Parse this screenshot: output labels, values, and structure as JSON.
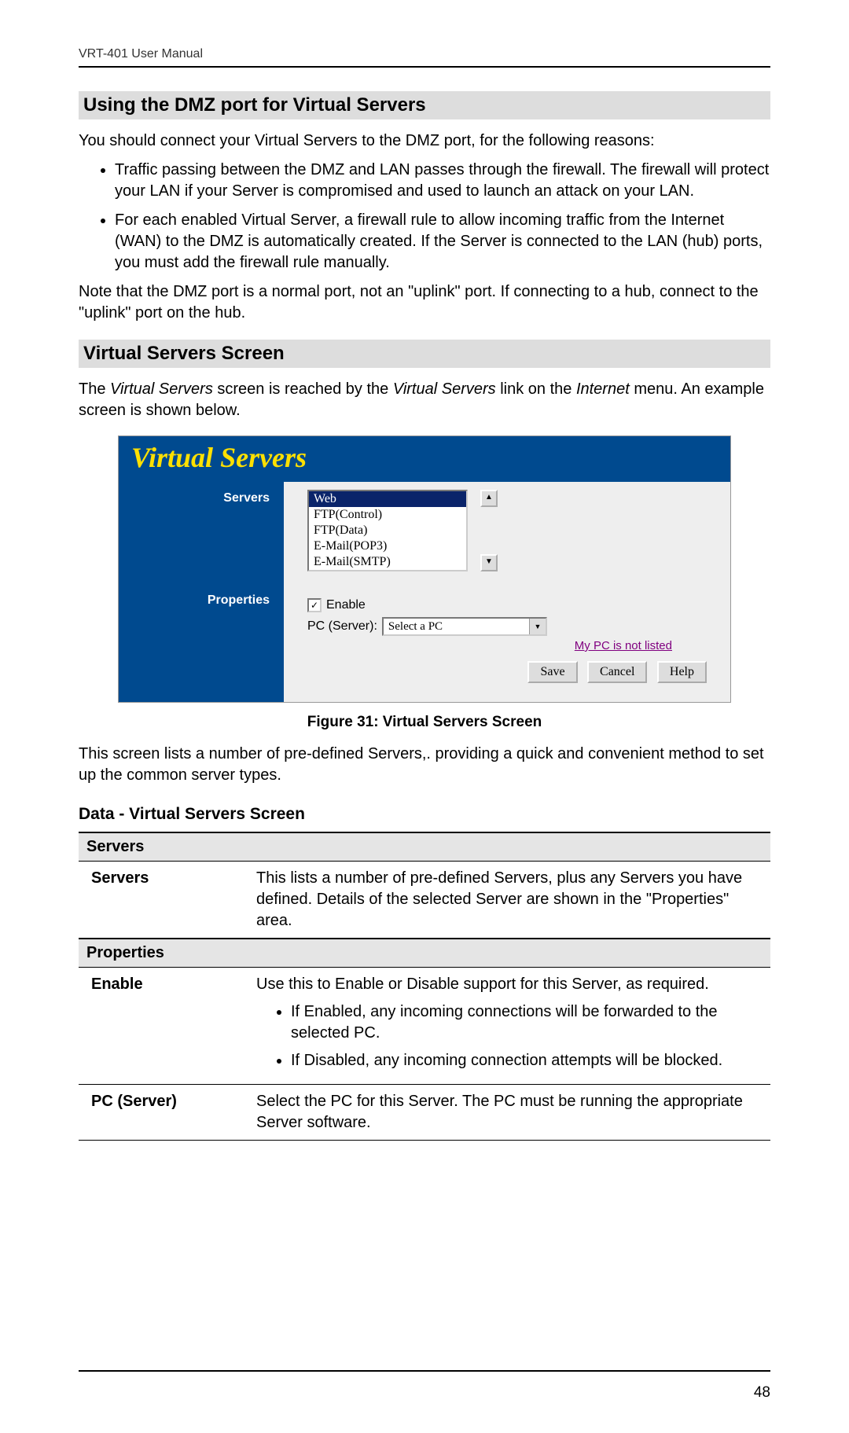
{
  "header": "VRT-401 User Manual",
  "section1": {
    "title": "Using the DMZ port for Virtual Servers",
    "intro": "You should connect your Virtual Servers to the DMZ port, for the following reasons:",
    "bullets": [
      "Traffic passing between the DMZ and LAN passes through the firewall. The firewall will protect your LAN if your Server is compromised and used to launch an attack on your LAN.",
      "For each enabled Virtual Server, a firewall rule to allow incoming traffic from the Internet (WAN) to the DMZ is automatically created. If the Server is connected to the LAN (hub) ports, you must add the firewall rule manually."
    ],
    "note": "Note that the DMZ port is a normal port, not an \"uplink\" port. If connecting to a hub, connect to the \"uplink\" port on the hub."
  },
  "section2": {
    "title": "Virtual Servers Screen",
    "intro_pre": "The ",
    "intro_em1": "Virtual Servers",
    "intro_mid1": " screen is reached by the ",
    "intro_em2": "Virtual Servers",
    "intro_mid2": " link on the ",
    "intro_em3": "Internet",
    "intro_post": " menu. An example screen is shown below."
  },
  "screenshot": {
    "title": "Virtual Servers",
    "label_servers": "Servers",
    "label_properties": "Properties",
    "options": [
      "Web",
      "FTP(Control)",
      "FTP(Data)",
      "E-Mail(POP3)",
      "E-Mail(SMTP)"
    ],
    "enable_label": "Enable",
    "pc_label": "PC (Server):",
    "pc_value": "Select a PC",
    "link": "My PC is not listed",
    "btn_save": "Save",
    "btn_cancel": "Cancel",
    "btn_help": "Help"
  },
  "figure_caption": "Figure 31: Virtual Servers Screen",
  "after_fig": "This screen lists a number of pre-defined Servers,. providing a quick and convenient method to set up the common server types.",
  "subhead": "Data - Virtual Servers Screen",
  "table": {
    "sect1": "Servers",
    "row1_k": "Servers",
    "row1_v": "This lists a number of pre-defined Servers, plus any Servers you have defined. Details of the selected Server are shown in the \"Properties\" area.",
    "sect2": "Properties",
    "row2_k": "Enable",
    "row2_v": "Use this to Enable or Disable support for this Server, as required.",
    "row2_b1": "If Enabled, any incoming connections will be forwarded to the selected PC.",
    "row2_b2": "If Disabled, any incoming connection attempts will be blocked.",
    "row3_k": "PC (Server)",
    "row3_v": "Select the PC for this Server. The PC must be running the appropriate Server software."
  },
  "page_number": "48"
}
